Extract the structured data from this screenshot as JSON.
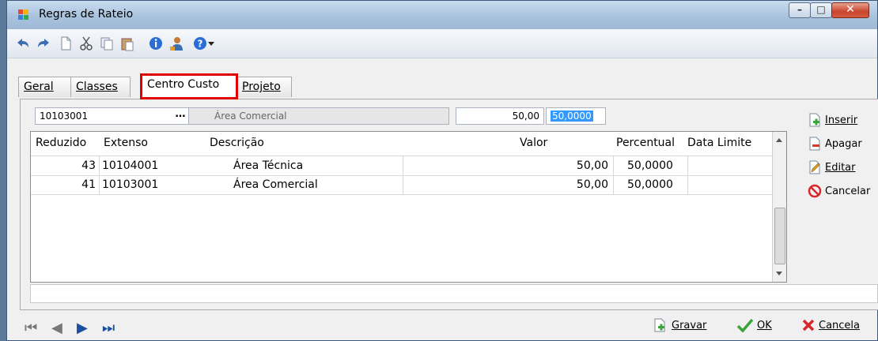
{
  "window": {
    "title": "Regras de Rateio"
  },
  "caption": {
    "minimize": "–",
    "maximize": "□",
    "close": "✕"
  },
  "tabs": [
    {
      "label": "Geral"
    },
    {
      "label": "Classes"
    },
    {
      "label": "Centro Custo"
    },
    {
      "label": "Projeto"
    }
  ],
  "form": {
    "code_value": "10103001",
    "lookup_label": "…",
    "description_value": "Área Comercial",
    "valor_value": "50,00",
    "percent_value": "50,0000"
  },
  "grid": {
    "columns": [
      "Reduzido",
      "Extenso",
      "Descrição",
      "Valor",
      "Percentual",
      "Data Limite"
    ],
    "rows": [
      {
        "reduzido": "43",
        "extenso": "10104001",
        "descricao": "Área Técnica",
        "valor": "50,00",
        "percentual": "50,0000",
        "data_limite": ""
      },
      {
        "reduzido": "41",
        "extenso": "10103001",
        "descricao": "Área Comercial",
        "valor": "50,00",
        "percentual": "50,0000",
        "data_limite": ""
      }
    ]
  },
  "side_buttons": {
    "inserir": "Inserir",
    "apagar": "Apagar",
    "editar": "Editar",
    "cancelar": "Cancelar"
  },
  "footer": {
    "gravar": "Gravar",
    "ok": "OK",
    "cancela": "Cancela"
  },
  "colors": {
    "highlight": "#e00000",
    "selection": "#3399ff",
    "nav_blue": "#1a4fa0"
  }
}
